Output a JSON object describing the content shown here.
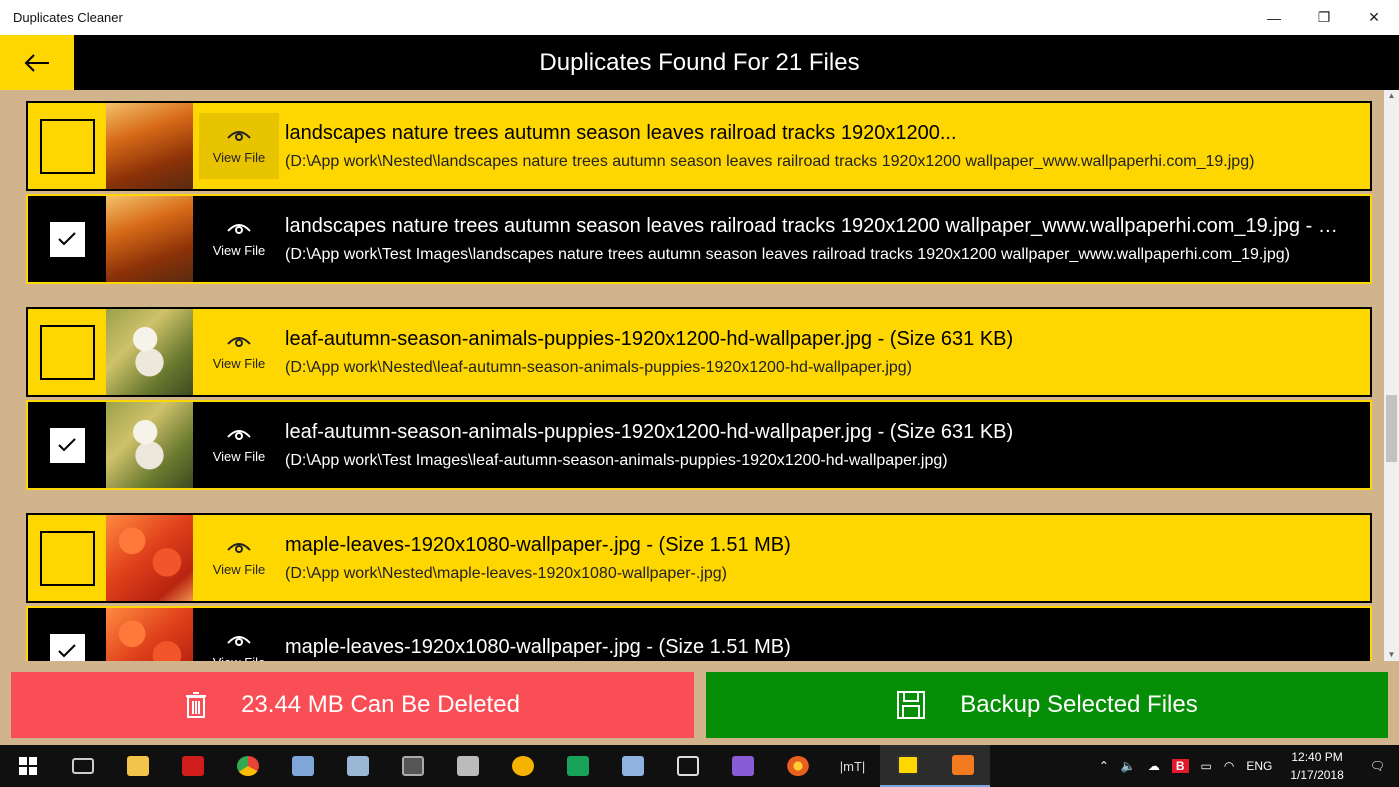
{
  "window": {
    "title": "Duplicates Cleaner",
    "controls": {
      "minimize": "—",
      "restore": "❐",
      "close": "✕"
    }
  },
  "header": {
    "title": "Duplicates Found For 21 Files",
    "back_icon": "back-arrow-icon"
  },
  "view_label": "View File",
  "groups": [
    {
      "original": {
        "name": "landscapes nature trees autumn season leaves railroad tracks 1920x1200...",
        "path": "(D:\\App work\\Nested\\landscapes nature trees autumn season leaves railroad tracks 1920x1200 wallpaper_www.wallpaperhi.com_19.jpg)",
        "checked": false
      },
      "duplicate": {
        "name": "landscapes nature trees autumn season leaves railroad tracks 1920x1200 wallpaper_www.wallpaperhi.com_19.jpg - (Size...",
        "path": "(D:\\App work\\Test Images\\landscapes nature trees autumn season leaves railroad tracks 1920x1200 wallpaper_www.wallpaperhi.com_19.jpg)",
        "checked": true
      }
    },
    {
      "original": {
        "name": "leaf-autumn-season-animals-puppies-1920x1200-hd-wallpaper.jpg - (Size 631 KB)",
        "path": "(D:\\App work\\Nested\\leaf-autumn-season-animals-puppies-1920x1200-hd-wallpaper.jpg)",
        "checked": false
      },
      "duplicate": {
        "name": "leaf-autumn-season-animals-puppies-1920x1200-hd-wallpaper.jpg - (Size 631 KB)",
        "path": "(D:\\App work\\Test Images\\leaf-autumn-season-animals-puppies-1920x1200-hd-wallpaper.jpg)",
        "checked": true
      }
    },
    {
      "original": {
        "name": "maple-leaves-1920x1080-wallpaper-.jpg - (Size 1.51 MB)",
        "path": "(D:\\App work\\Nested\\maple-leaves-1920x1080-wallpaper-.jpg)",
        "checked": false
      },
      "duplicate": {
        "name": "maple-leaves-1920x1080-wallpaper-.jpg - (Size 1.51 MB)",
        "path": "",
        "checked": true
      }
    }
  ],
  "actions": {
    "delete_label": "23.44 MB Can Be Deleted",
    "backup_label": "Backup Selected Files"
  },
  "taskbar": {
    "language": "ENG",
    "time": "12:40 PM",
    "date": "1/17/2018",
    "mt_label": "|mT|"
  },
  "colors": {
    "accent_yellow": "#ffd700",
    "background_tan": "#d2b48c",
    "delete_red": "#f94e55",
    "backup_green": "#068f06"
  }
}
